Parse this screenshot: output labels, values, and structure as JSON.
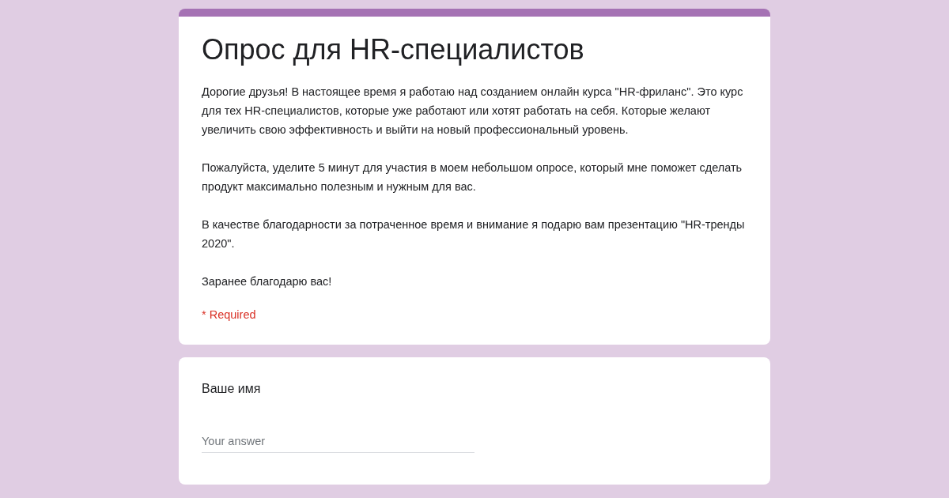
{
  "form": {
    "title": "Опрос для HR-специалистов",
    "description": [
      "Дорогие друзья! В настоящее время я работаю над созданием онлайн курса \"HR-фриланс\". Это курс для тех HR-специалистов, которые уже работают или хотят работать на себя. Которые желают увеличить свою эффективность и выйти на новый профессиональный уровень.",
      "Пожалуйста, уделите 5 минут для участия в моем небольшом опросе, который мне поможет сделать продукт максимально полезным и нужным для вас.",
      "В качестве благодарности за потраченное время и внимание я подарю вам презентацию \"HR-тренды 2020\".",
      "Заранее благодарю вас!"
    ],
    "required_note": "* Required"
  },
  "questions": [
    {
      "title": "Ваше имя",
      "placeholder": "Your answer"
    }
  ]
}
